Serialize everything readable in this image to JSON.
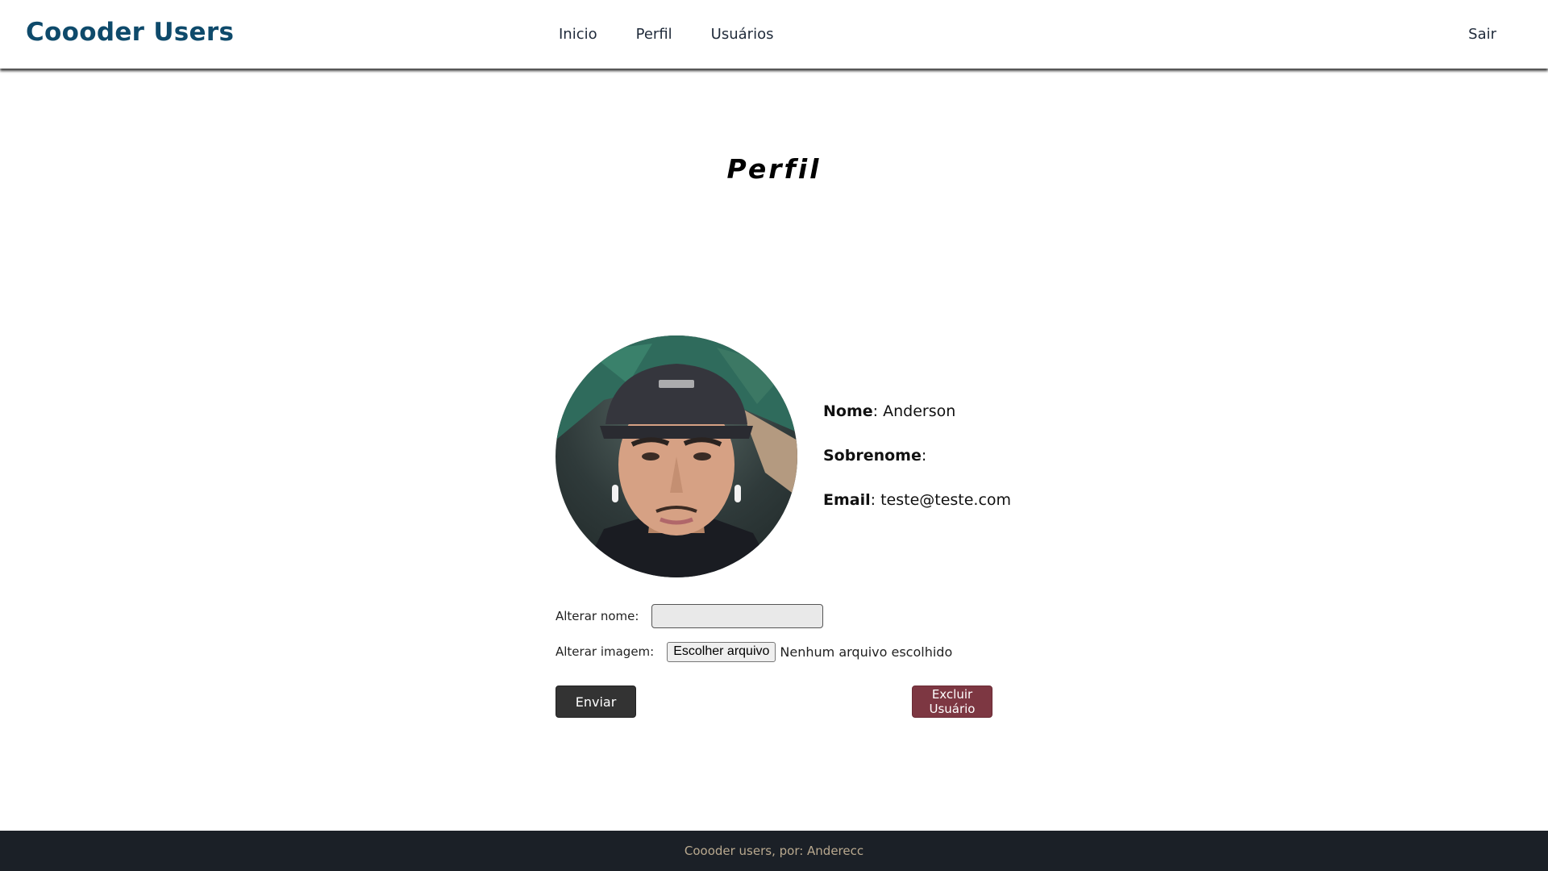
{
  "navbar": {
    "brand": "Coooder Users",
    "links": [
      {
        "label": "Inicio"
      },
      {
        "label": "Perfil"
      },
      {
        "label": "Usuários"
      }
    ],
    "logout_label": "Sair"
  },
  "page": {
    "title": "Perfil"
  },
  "profile": {
    "nome_label": "Nome",
    "nome_value": "Anderson",
    "sobrenome_label": "Sobrenome",
    "sobrenome_value": "",
    "email_label": "Email",
    "email_value": "teste@teste.com"
  },
  "form": {
    "alterar_nome_label": "Alterar nome:",
    "alterar_nome_value": "",
    "alterar_imagem_label": "Alterar imagem:",
    "file_button_label": "Escolher arquivo",
    "file_status": "Nenhum arquivo escolhido",
    "submit_label": "Enviar",
    "delete_label": "Excluir Usuário"
  },
  "footer": {
    "text": "Coooder users, por: Anderecc"
  },
  "colors": {
    "brand": "#0e4a6b",
    "footer_bg": "#1b2027",
    "delete_button": "#7d3742",
    "submit_button": "#333333"
  }
}
